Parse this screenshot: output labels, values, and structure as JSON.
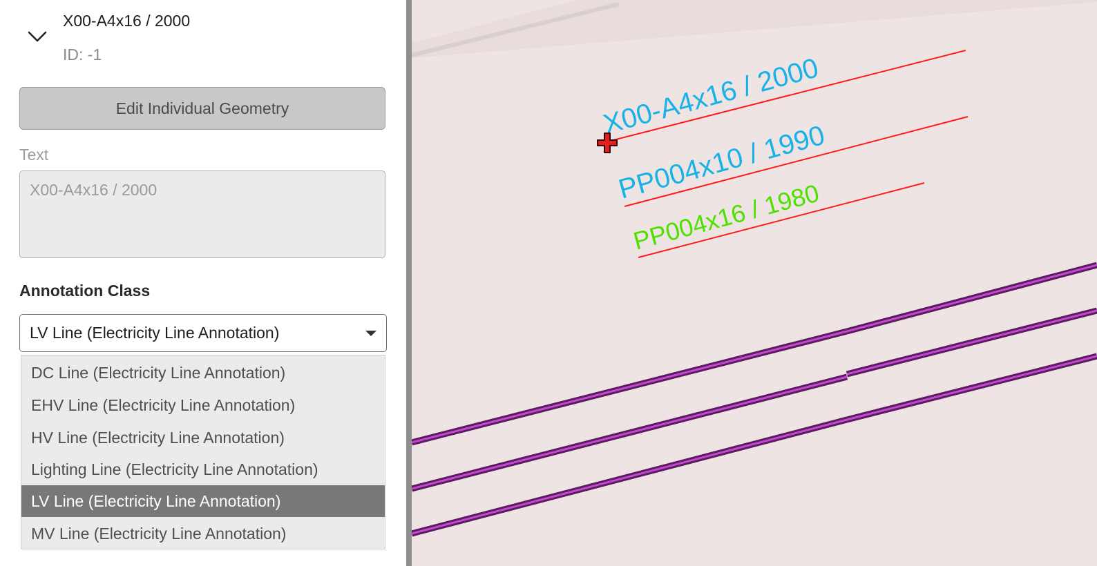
{
  "feature": {
    "title": "X00-A4x16 / 2000",
    "id_text": "ID: -1"
  },
  "buttons": {
    "edit_geometry": "Edit Individual Geometry"
  },
  "text_field": {
    "label": "Text",
    "value": "X00-A4x16 / 2000"
  },
  "annotation_class": {
    "label": "Annotation Class",
    "selected": "LV Line (Electricity Line Annotation)",
    "options": [
      "DC Line (Electricity Line Annotation)",
      "EHV Line (Electricity Line Annotation)",
      "HV Line (Electricity Line Annotation)",
      "Lighting Line (Electricity Line Annotation)",
      "LV Line (Electricity Line Annotation)",
      "MV Line (Electricity Line Annotation)"
    ],
    "highlighted_index": 4
  },
  "map": {
    "annotations": [
      {
        "text": "X00-A4x16 / 2000",
        "color": "#19b2e6"
      },
      {
        "text": "PP004x10 / 1990",
        "color": "#19b2e6"
      },
      {
        "text": "PP004x16 / 1980",
        "color": "#4fe000"
      }
    ],
    "leader_color": "#ff1a1a",
    "cable_color": "#c34ad0",
    "cable_outline_color": "#5a1c5e",
    "background_color": "#efe4e4",
    "cursor_icon": "crosshair-plus-icon"
  }
}
